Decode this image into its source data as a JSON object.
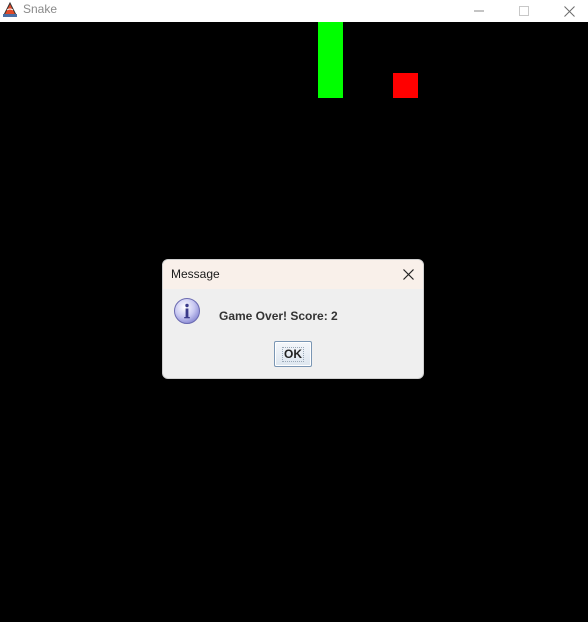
{
  "window": {
    "title": "Snake",
    "controls": [
      "minimize",
      "maximize",
      "close"
    ]
  },
  "game": {
    "background_color": "#000000",
    "snake_color": "#00ff00",
    "food_color": "#ff0000"
  },
  "dialog": {
    "title": "Message",
    "icon": "info-icon",
    "message": "Game Over! Score: 2",
    "ok_label": "OK"
  }
}
